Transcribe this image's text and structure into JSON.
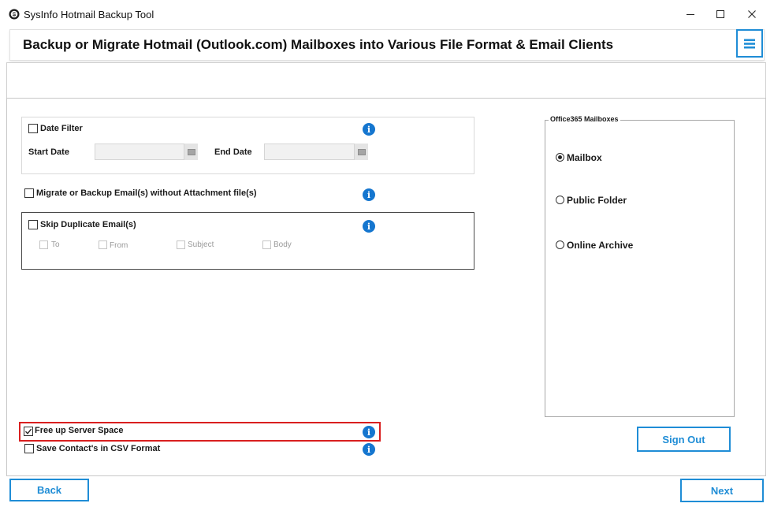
{
  "window": {
    "title": "SysInfo Hotmail Backup Tool",
    "controls": {
      "minimize": "—",
      "maximize": "☐",
      "close": "✕"
    }
  },
  "header": {
    "title": "Backup or Migrate Hotmail (Outlook.com) Mailboxes into Various File Format & Email Clients"
  },
  "date_filter": {
    "label": "Date Filter",
    "checked": false,
    "start_label": "Start Date",
    "start_value": "",
    "end_label": "End Date",
    "end_value": ""
  },
  "options": {
    "no_attachments": {
      "label": "Migrate or Backup Email(s) without Attachment file(s)",
      "checked": false
    },
    "skip_duplicates": {
      "label": "Skip Duplicate Email(s)",
      "checked": false,
      "criteria": [
        {
          "label": "To",
          "checked": false
        },
        {
          "label": "From",
          "checked": false
        },
        {
          "label": "Subject",
          "checked": false
        },
        {
          "label": "Body",
          "checked": false
        }
      ]
    },
    "free_up_space": {
      "label": "Free up Server Space",
      "checked": true
    },
    "contacts_csv": {
      "label": "Save Contact's in CSV Format",
      "checked": false
    }
  },
  "mailboxes": {
    "legend": "Office365 Mailboxes",
    "selected": "Mailbox",
    "items": [
      {
        "label": "Mailbox",
        "selected": true
      },
      {
        "label": "Public Folder",
        "selected": false
      },
      {
        "label": "Online Archive",
        "selected": false
      }
    ]
  },
  "buttons": {
    "sign_out": "Sign Out",
    "back": "Back",
    "next": "Next"
  },
  "info_glyph": "i",
  "colors": {
    "accent": "#1f8dd6",
    "info": "#1576cf",
    "highlight": "#d91f1f"
  },
  "icons": [
    "app-logo-icon",
    "hamburger-menu-icon",
    "info-icon",
    "calendar-icon",
    "checkmark-icon"
  ]
}
